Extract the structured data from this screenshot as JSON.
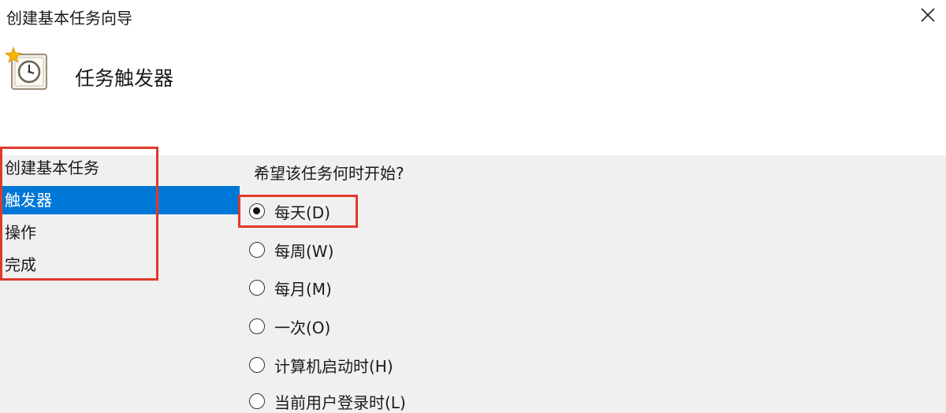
{
  "window": {
    "title": "创建基本任务向导",
    "close_icon": "close-icon"
  },
  "header": {
    "icon": "task-scheduler-clock-icon",
    "title": "任务触发器"
  },
  "sidebar": {
    "items": [
      {
        "label": "创建基本任务",
        "selected": false
      },
      {
        "label": "触发器",
        "selected": true
      },
      {
        "label": "操作",
        "selected": false
      },
      {
        "label": "完成",
        "selected": false
      }
    ]
  },
  "main": {
    "question": "希望该任务何时开始?",
    "options": [
      {
        "label": "每天(D)",
        "checked": true
      },
      {
        "label": "每周(W)",
        "checked": false
      },
      {
        "label": "每月(M)",
        "checked": false
      },
      {
        "label": "一次(O)",
        "checked": false
      },
      {
        "label": "计算机启动时(H)",
        "checked": false
      },
      {
        "label": "当前用户登录时(L)",
        "checked": false
      }
    ]
  },
  "colors": {
    "selection": "#0078d7",
    "annotation": "#e0392b",
    "header_bg": "#ffffff",
    "content_bg": "#f0f0f0"
  }
}
